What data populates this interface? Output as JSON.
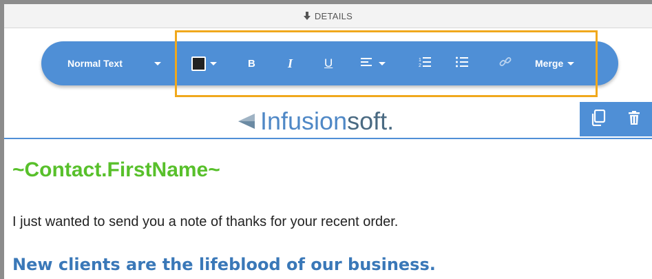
{
  "details_bar": {
    "label": "DETAILS"
  },
  "toolbar": {
    "text_style": "Normal Text",
    "bold": "B",
    "italic": "I",
    "underline": "U",
    "merge": "Merge"
  },
  "logo": {
    "part_bold": "Infusion",
    "part_light": "soft."
  },
  "content": {
    "greeting": "~Contact.FirstName~",
    "body": "I just wanted to send you a note of thanks for your recent order.",
    "subheading": "New clients are the lifeblood of our business."
  },
  "colors": {
    "toolbar": "#4f8fd6",
    "highlight": "#f0a81c",
    "greeting": "#58c02b",
    "subheading": "#3a78b8"
  }
}
